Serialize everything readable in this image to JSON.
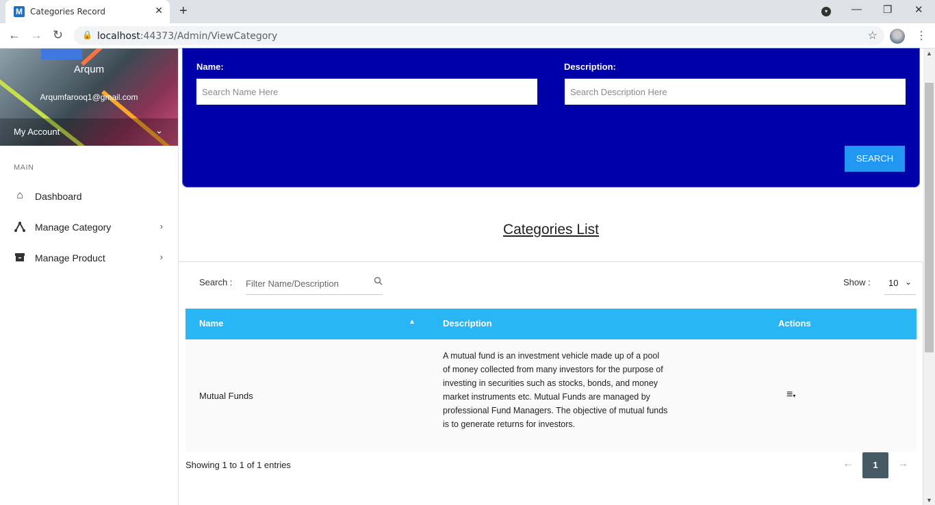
{
  "browser": {
    "tab_title": "Categories Record",
    "tab_favicon_letter": "M",
    "url_host": "localhost",
    "url_rest": ":44373/Admin/ViewCategory"
  },
  "sidebar": {
    "profile_name": "Arqum",
    "profile_email": "Arqumfarooq1@gmail.com",
    "account_label": "My Account",
    "section_label": "MAIN",
    "items": [
      {
        "label": "Dashboard",
        "icon": "home-icon"
      },
      {
        "label": "Manage Category",
        "icon": "category-tree-icon"
      },
      {
        "label": "Manage Product",
        "icon": "archive-box-icon"
      }
    ]
  },
  "search_panel": {
    "name_label": "Name:",
    "name_placeholder": "Search Name Here",
    "description_label": "Description:",
    "description_placeholder": "Search Description Here",
    "search_button": "SEARCH",
    "background_color": "#0000a8",
    "button_color": "#2196f3"
  },
  "list": {
    "title": "Categories List",
    "filter_label": "Search :",
    "filter_placeholder": "Filter Name/Description",
    "show_label": "Show :",
    "show_value": "10",
    "header_color": "#29b6f6",
    "columns": {
      "name": "Name",
      "description": "Description",
      "actions": "Actions"
    },
    "rows": [
      {
        "name": "Mutual Funds",
        "description": "A mutual fund is an investment vehicle made up of a pool of money collected from many investors for the purpose of investing in securities such as stocks, bonds, and money market instruments etc. Mutual Funds are managed by professional Fund Managers. The objective of mutual funds is to generate returns for investors."
      }
    ],
    "showing_text": "Showing 1 to 1 of 1 entries",
    "current_page": "1"
  }
}
